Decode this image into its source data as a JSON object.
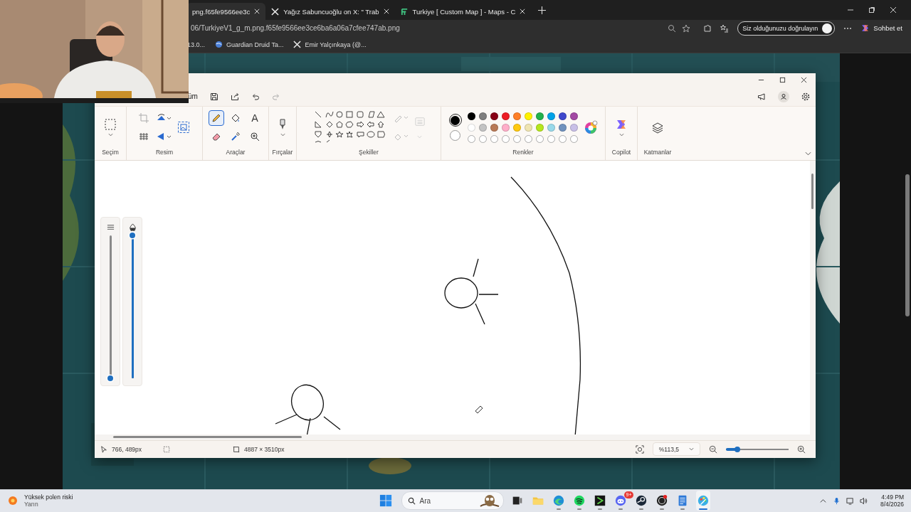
{
  "browser": {
    "tabs": [
      {
        "title": "png.f65fe9566ee3c",
        "selected": true,
        "kind": "page"
      },
      {
        "title": "Yağız Sabuncuoğlu on X: \" Trab",
        "selected": false,
        "kind": "x"
      },
      {
        "title": "Turkiye [ Custom Map ] - Maps - C",
        "selected": false,
        "kind": "site"
      }
    ],
    "address": "06/TurkiyeV1_g_m.png.f65fe9566ee3ce6ba6a06a7cfee747ab.png",
    "verify_button": "Siz olduğunuzu doğrulayın",
    "chat_button": "Sohbet et",
    "bookmarks": [
      {
        "label": "13.0...",
        "kind": "plain"
      },
      {
        "label": "Guardian Druid Ta...",
        "kind": "site"
      },
      {
        "label": "Emir Yalçınkaya (@...",
        "kind": "x"
      }
    ]
  },
  "paint": {
    "menu": [
      "üm"
    ],
    "groups": [
      "Seçim",
      "Resim",
      "Araçlar",
      "Fırçalar",
      "Şekiller",
      "Renkler",
      "Copilot",
      "Katmanlar"
    ],
    "tools": [
      {
        "kind": "pencil",
        "selected": true
      },
      {
        "kind": "fill",
        "selected": false
      },
      {
        "kind": "text",
        "glyph": "A",
        "selected": false
      },
      {
        "kind": "eraser",
        "selected": false
      },
      {
        "kind": "picker",
        "selected": false
      },
      {
        "kind": "magnifier",
        "selected": false
      }
    ],
    "current_colors": [
      {
        "color": "#000000"
      },
      {
        "color": "#ffffff"
      }
    ],
    "palette": [
      {
        "kind": "swatch",
        "color": "#000000"
      },
      {
        "kind": "swatch",
        "color": "#7f7f7f"
      },
      {
        "kind": "swatch",
        "color": "#880015"
      },
      {
        "kind": "swatch",
        "color": "#ed1c24"
      },
      {
        "kind": "swatch",
        "color": "#ff7f27"
      },
      {
        "kind": "swatch",
        "color": "#fff200"
      },
      {
        "kind": "swatch",
        "color": "#22b14c"
      },
      {
        "kind": "swatch",
        "color": "#00a2e8"
      },
      {
        "kind": "swatch",
        "color": "#3f48cc"
      },
      {
        "kind": "swatch",
        "color": "#a349a4"
      },
      {
        "kind": "swatch",
        "color": "#ffffff"
      },
      {
        "kind": "swatch",
        "color": "#c3c3c3"
      },
      {
        "kind": "swatch",
        "color": "#b97a57"
      },
      {
        "kind": "swatch",
        "color": "#ffaec9"
      },
      {
        "kind": "swatch",
        "color": "#ffc90e"
      },
      {
        "kind": "swatch",
        "color": "#efe4b0"
      },
      {
        "kind": "swatch",
        "color": "#b5e61d"
      },
      {
        "kind": "swatch",
        "color": "#99d9ea"
      },
      {
        "kind": "swatch",
        "color": "#7092be"
      },
      {
        "kind": "swatch",
        "color": "#c8bfe7"
      },
      {
        "kind": "empty"
      },
      {
        "kind": "empty"
      },
      {
        "kind": "empty"
      },
      {
        "kind": "empty"
      },
      {
        "kind": "empty"
      },
      {
        "kind": "empty"
      },
      {
        "kind": "empty"
      },
      {
        "kind": "empty"
      },
      {
        "kind": "empty"
      },
      {
        "kind": "empty"
      }
    ],
    "sliders": [
      {
        "kind": "size",
        "level": 0
      },
      {
        "kind": "opacity",
        "level": 1
      }
    ],
    "status": {
      "position": "766, 489px",
      "canvas_size": "4887 × 3510px",
      "zoom": "%113,5",
      "zoom_slider": {
        "level": 0.18
      }
    }
  },
  "taskbar": {
    "weather_title": "Yüksek polen riski",
    "weather_subtitle": "Yarın",
    "search_placeholder": "Ara",
    "apps": [
      {
        "kind": "taskview",
        "running": false,
        "active": false
      },
      {
        "kind": "folder",
        "running": false,
        "active": false
      },
      {
        "kind": "edge",
        "running": true,
        "active": false
      },
      {
        "kind": "spotify",
        "running": true,
        "active": false
      },
      {
        "kind": "player",
        "running": true,
        "active": false
      },
      {
        "kind": "discord",
        "running": true,
        "active": false,
        "badge": "9+"
      },
      {
        "kind": "steam",
        "running": true,
        "active": false
      },
      {
        "kind": "obs",
        "running": true,
        "active": false
      },
      {
        "kind": "notepad",
        "running": true,
        "active": false
      },
      {
        "kind": "paint",
        "running": true,
        "active": true
      }
    ],
    "time": "4:49 PM",
    "date": "8/4/2026"
  }
}
